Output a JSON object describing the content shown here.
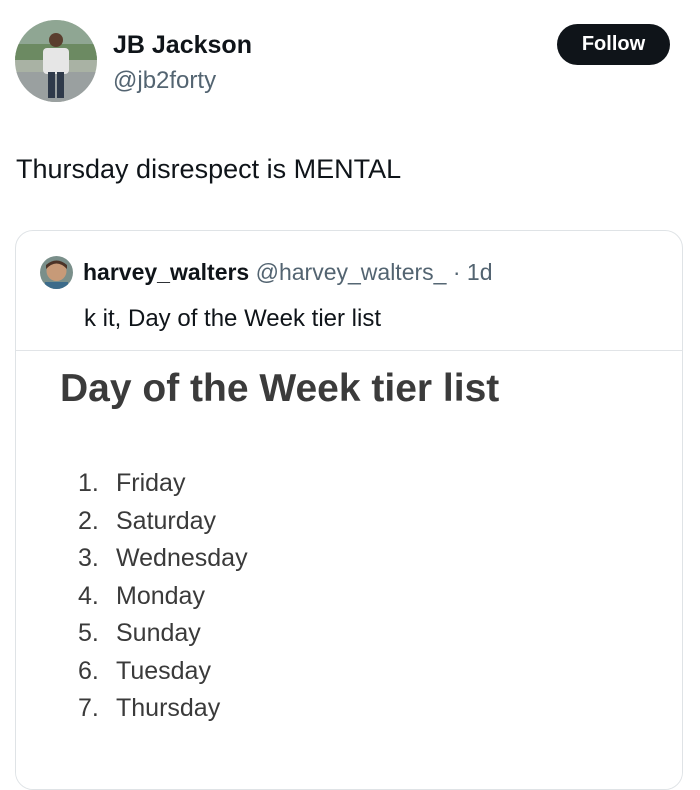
{
  "tweet": {
    "display_name": "JB Jackson",
    "handle": "@jb2forty",
    "follow_label": "Follow",
    "text": "Thursday disrespect is MENTAL"
  },
  "quoted": {
    "display_name": "harvey_walters",
    "handle": "@harvey_walters_",
    "separator": "·",
    "time": "1d",
    "text": "k it, Day of the Week tier list",
    "image": {
      "title": "Day of the Week tier list",
      "items": [
        {
          "num": "1.",
          "day": "Friday"
        },
        {
          "num": "2.",
          "day": "Saturday"
        },
        {
          "num": "3.",
          "day": "Wednesday"
        },
        {
          "num": "4.",
          "day": "Monday"
        },
        {
          "num": "5.",
          "day": "Sunday"
        },
        {
          "num": "6.",
          "day": "Tuesday"
        },
        {
          "num": "7.",
          "day": "Thursday"
        }
      ]
    }
  },
  "colors": {
    "follow_bg": "#0f1419",
    "secondary_text": "#536471",
    "border": "#dfe3e6"
  }
}
